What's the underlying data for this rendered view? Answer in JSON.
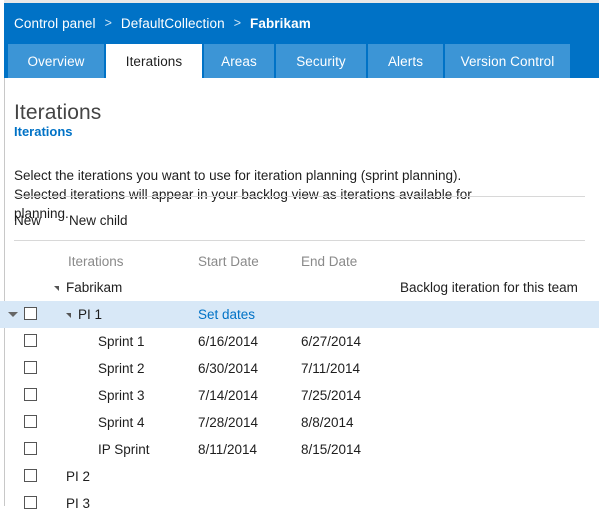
{
  "header": {
    "breadcrumb": {
      "separator": ">",
      "items": [
        {
          "label": "Control panel",
          "current": false
        },
        {
          "label": "DefaultCollection",
          "current": false
        },
        {
          "label": "Fabrikam",
          "current": true
        }
      ]
    },
    "tabs": [
      {
        "label": "Overview",
        "active": false
      },
      {
        "label": "Iterations",
        "active": true
      },
      {
        "label": "Areas",
        "active": false
      },
      {
        "label": "Security",
        "active": false
      },
      {
        "label": "Alerts",
        "active": false
      },
      {
        "label": "Version Control",
        "active": false
      }
    ]
  },
  "main": {
    "page_title": "Iterations",
    "section_link": "Iterations",
    "description": "Select the iterations you want to use for iteration planning (sprint planning). Selected iterations will appear in your backlog view as iterations available for planning.",
    "toolbar": {
      "new_label": "New",
      "new_child_label": "New child"
    },
    "grid": {
      "columns": {
        "iterations": "Iterations",
        "start_date": "Start Date",
        "end_date": "End Date"
      },
      "root": {
        "name": "Fabrikam",
        "note": "Backlog iteration for this team",
        "expander": "triangle-expanded-icon"
      },
      "rows": [
        {
          "name": "PI 1",
          "start_date": "Set dates",
          "start_is_link": true,
          "end_date": "",
          "indent": 1,
          "expandable": true,
          "selected": true,
          "checked": false
        },
        {
          "name": "Sprint 1",
          "start_date": "6/16/2014",
          "start_is_link": false,
          "end_date": "6/27/2014",
          "indent": 2,
          "expandable": false,
          "selected": false,
          "checked": false
        },
        {
          "name": "Sprint 2",
          "start_date": "6/30/2014",
          "start_is_link": false,
          "end_date": "7/11/2014",
          "indent": 2,
          "expandable": false,
          "selected": false,
          "checked": false
        },
        {
          "name": "Sprint 3",
          "start_date": "7/14/2014",
          "start_is_link": false,
          "end_date": "7/25/2014",
          "indent": 2,
          "expandable": false,
          "selected": false,
          "checked": false
        },
        {
          "name": "Sprint 4",
          "start_date": "7/28/2014",
          "start_is_link": false,
          "end_date": "8/8/2014",
          "indent": 2,
          "expandable": false,
          "selected": false,
          "checked": false
        },
        {
          "name": "IP Sprint",
          "start_date": "8/11/2014",
          "start_is_link": false,
          "end_date": "8/15/2014",
          "indent": 2,
          "expandable": false,
          "selected": false,
          "checked": false
        },
        {
          "name": "PI 2",
          "start_date": "",
          "start_is_link": false,
          "end_date": "",
          "indent": 1,
          "expandable": false,
          "selected": false,
          "checked": false
        },
        {
          "name": "PI 3",
          "start_date": "",
          "start_is_link": false,
          "end_date": "",
          "indent": 1,
          "expandable": false,
          "selected": false,
          "checked": false
        }
      ]
    }
  },
  "colors": {
    "header_blue": "#0072c6",
    "tab_blue": "#3c95d6",
    "link_blue": "#0072c6",
    "selection_blue": "#d8e8f7"
  }
}
